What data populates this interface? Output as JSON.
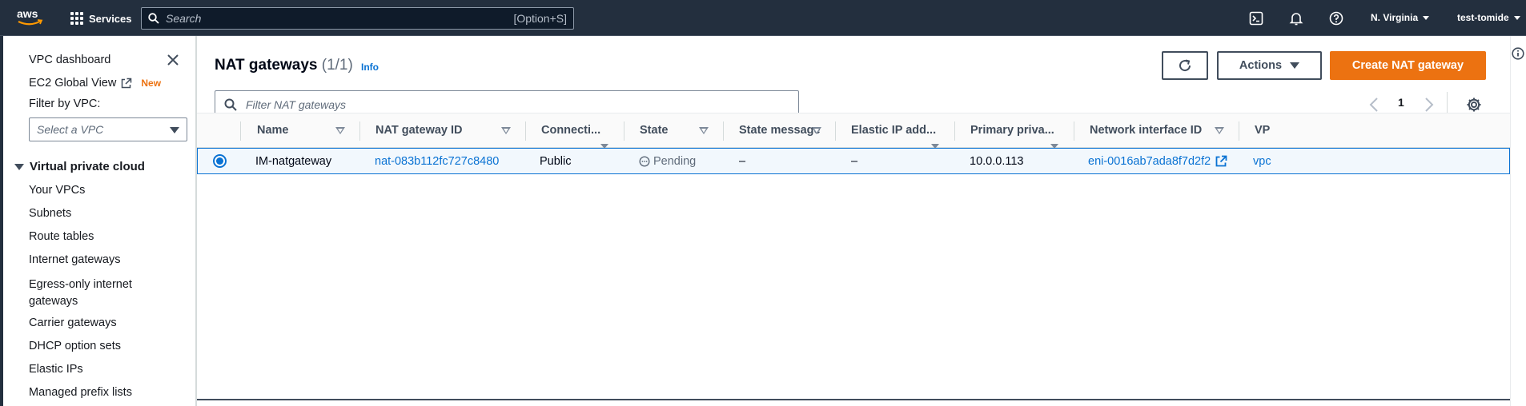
{
  "topbar": {
    "brand": "aws",
    "services_label": "Services",
    "search_placeholder": "Search",
    "search_shortcut": "[Option+S]",
    "region": "N. Virginia",
    "user": "test-tomide",
    "icons": [
      "cloudshell-icon",
      "bell-icon",
      "help-icon"
    ]
  },
  "sidebar": {
    "dashboard": "VPC dashboard",
    "global_view": "EC2 Global View",
    "new_badge": "New",
    "filter_label": "Filter by VPC:",
    "select_placeholder": "Select a VPC",
    "section": "Virtual private cloud",
    "items": [
      "Your VPCs",
      "Subnets",
      "Route tables",
      "Internet gateways",
      "Egress-only internet gateways",
      "Carrier gateways",
      "DHCP option sets",
      "Elastic IPs",
      "Managed prefix lists"
    ]
  },
  "main": {
    "title": "NAT gateways",
    "count": "(1/1)",
    "info": "Info",
    "actions_label": "Actions",
    "create_label": "Create NAT gateway",
    "filter_placeholder": "Filter NAT gateways",
    "page_number": "1"
  },
  "table": {
    "columns": {
      "name": "Name",
      "id": "NAT gateway ID",
      "conn": "Connecti...",
      "state": "State",
      "state_message": "State message",
      "eip": "Elastic IP add...",
      "primary": "Primary priva...",
      "eni": "Network interface ID",
      "vpc": "VP"
    },
    "row": {
      "name": "IM-natgateway",
      "id": "nat-083b112fc727c8480",
      "conn": "Public",
      "state": "Pending",
      "state_message": "–",
      "eip": "–",
      "primary": "10.0.0.113",
      "eni": "eni-0016ab7ada8f7d2f2",
      "vpc": "vpc"
    }
  },
  "colors": {
    "topbar": "#232f3e",
    "link": "#0972d3",
    "primary_button": "#ec7211",
    "selected_row": "#f2f8fd"
  }
}
